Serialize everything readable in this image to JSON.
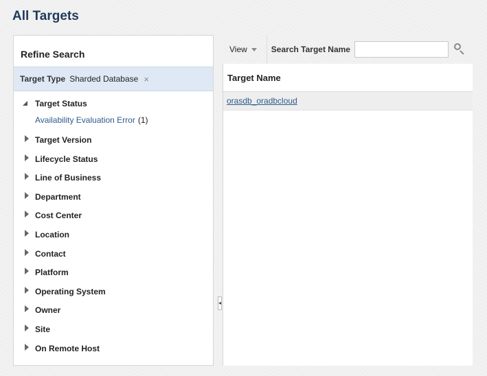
{
  "page": {
    "title": "All Targets"
  },
  "refine": {
    "title": "Refine Search",
    "filter": {
      "label": "Target Type",
      "value": "Sharded Database",
      "remove_glyph": "×"
    },
    "target_status": {
      "label": "Target Status",
      "expanded": true,
      "options": [
        {
          "label": "Availability Evaluation Error",
          "count": "(1)"
        }
      ]
    },
    "facets": [
      "Target Version",
      "Lifecycle Status",
      "Line of Business",
      "Department",
      "Cost Center",
      "Location",
      "Contact",
      "Platform",
      "Operating System",
      "Owner",
      "Site",
      "On Remote Host"
    ]
  },
  "toolbar": {
    "view_label": "View",
    "search_label": "Search Target Name",
    "search_value": "",
    "search_icon": "magnifier-icon"
  },
  "results": {
    "columns": [
      "Target Name"
    ],
    "rows": [
      {
        "target_name": "orasdb_oradbcloud"
      }
    ]
  },
  "splitter": {
    "glyph": "◂"
  }
}
